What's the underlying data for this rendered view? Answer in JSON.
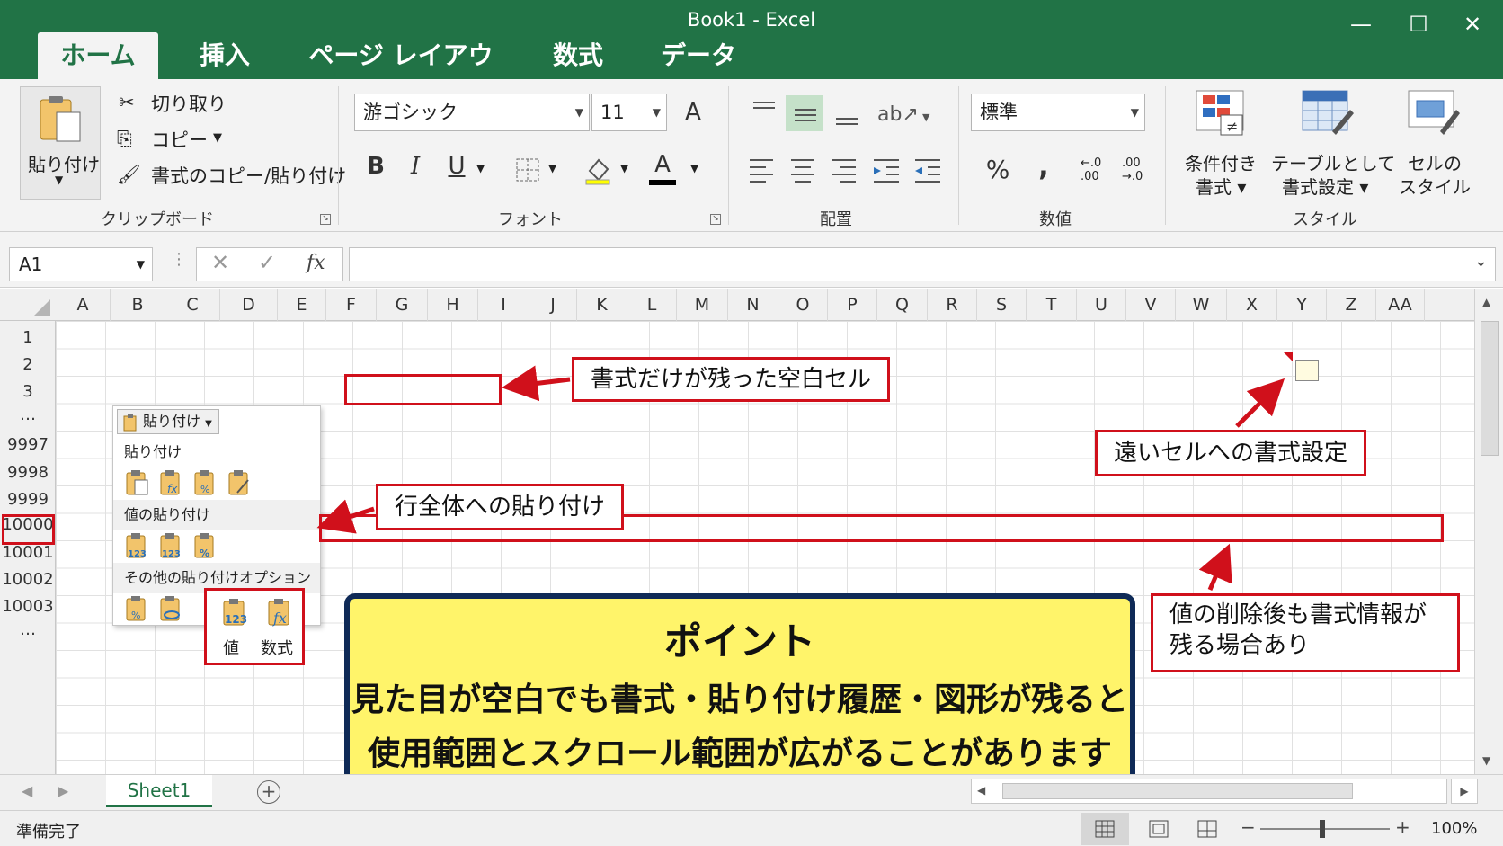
{
  "window": {
    "title": "Book1  -  Excel",
    "controls": [
      "—",
      "☐",
      "✕"
    ]
  },
  "tabs": [
    {
      "label": "ホーム",
      "active": true
    },
    {
      "label": "挿入"
    },
    {
      "label": "ページ レイアウト"
    },
    {
      "label": "数式"
    },
    {
      "label": "データ"
    }
  ],
  "ribbon": {
    "clipboard": {
      "paste_label": "貼り付け",
      "cut_label": "切り取り",
      "copy_label": "コピー",
      "format_painter_label": "書式のコピー/貼り付け",
      "group_label": "クリップボード"
    },
    "font": {
      "font_name": "游ゴシック",
      "font_size": "11",
      "bold": "B",
      "italic": "I",
      "underline": "U",
      "font_color_glyph": "A",
      "grow_glyph": "A",
      "group_label": "フォント"
    },
    "alignment": {
      "group_label": "配置"
    },
    "number": {
      "format": "標準",
      "percent": "%",
      "comma": ",",
      "inc_decimal_a": "←.0",
      "inc_decimal_b": ".00",
      "dec_decimal_a": ".00",
      "dec_decimal_b": "→.0",
      "group_label": "数値"
    },
    "styles": {
      "conditional_line1": "条件付き",
      "conditional_line2": "書式 ▾",
      "table_line1": "テーブルとして",
      "table_line2": "書式設定 ▾",
      "cell_line1": "セルの",
      "cell_line2": "スタイル",
      "group_label": "スタイル"
    }
  },
  "formula_bar": {
    "name_box": "A1",
    "fx": "fx",
    "cancel": "✕",
    "confirm": "✓",
    "value": ""
  },
  "grid": {
    "columns": [
      "A",
      "B",
      "C",
      "D",
      "E",
      "F",
      "G",
      "H",
      "I",
      "J",
      "K",
      "L",
      "M",
      "N",
      "O",
      "P",
      "Q",
      "R",
      "S",
      "T",
      "U",
      "V",
      "W",
      "X",
      "Y",
      "Z",
      "AA"
    ],
    "rows": [
      "1",
      "2",
      "3",
      "…",
      "9997",
      "9998",
      "9999",
      "10000",
      "10001",
      "10002",
      "10003",
      "…"
    ]
  },
  "paste_menu": {
    "button_label": "貼り付け",
    "section_paste": "貼り付け",
    "section_values": "値の貼り付け",
    "section_other": "その他の貼り付けオプション",
    "value_label": "値",
    "formula_label": "数式"
  },
  "annotations": {
    "blank_cell": "書式だけが残った空白セル",
    "far_cell": "遠いセルへの書式設定",
    "whole_row": "行全体への貼り付け",
    "after_delete_line1": "値の削除後も書式情報が",
    "after_delete_line2": "残る場合あり"
  },
  "point": {
    "title": "ポイント",
    "line1": "見た目が空白でも書式・貼り付け履歴・図形が残ると",
    "line2": "使用範囲とスクロール範囲が広がることがあります"
  },
  "sheets": {
    "active": "Sheet1",
    "add": "+"
  },
  "status": {
    "ready": "準備完了",
    "zoom": "100%",
    "zoom_minus": "−",
    "zoom_plus": "+"
  },
  "colors": {
    "excel_green": "#217346",
    "annotation_red": "#d0101b",
    "point_yellow": "#fff46a",
    "point_border": "#0f2a57"
  }
}
